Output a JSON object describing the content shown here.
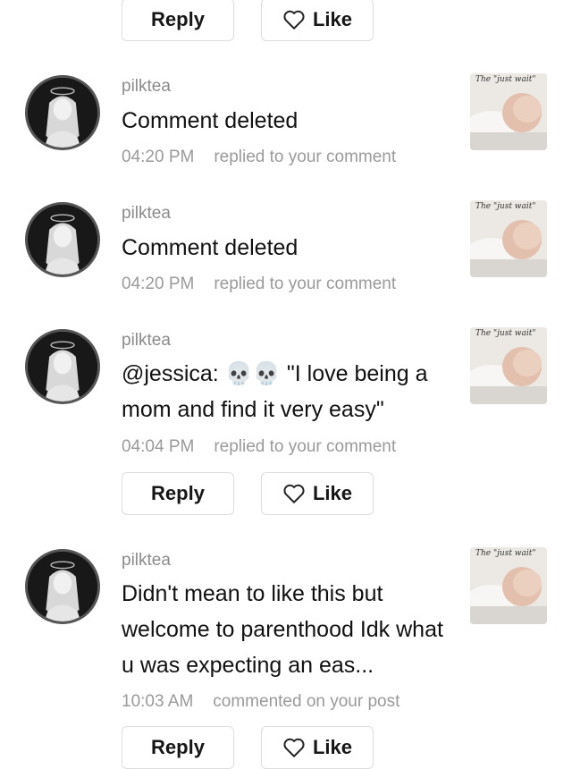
{
  "labels": {
    "reply": "Reply",
    "like": "Like"
  },
  "notifications": [
    {
      "username": "pilktea",
      "text": "Comment deleted",
      "time": "04:20 PM",
      "action": "replied to your comment",
      "thumb_caption": "The \"just wait\""
    },
    {
      "username": "pilktea",
      "text": "Comment deleted",
      "time": "04:20 PM",
      "action": "replied to your comment",
      "thumb_caption": "The \"just wait\""
    },
    {
      "username": "pilktea",
      "text": "@jessica: 💀💀 \"I love being a mom and find it very easy\"",
      "time": "04:04 PM",
      "action": "replied to your comment",
      "thumb_caption": "The \"just wait\""
    },
    {
      "username": "pilktea",
      "text": "Didn't mean to like this but welcome to parenthood Idk what u was expecting an eas...",
      "time": "10:03 AM",
      "action": "commented on your post",
      "thumb_caption": "The \"just wait\""
    }
  ],
  "colors": {
    "accent_text": "#111111",
    "muted_text": "#9a9a9a",
    "button_border": "#dddddd"
  }
}
